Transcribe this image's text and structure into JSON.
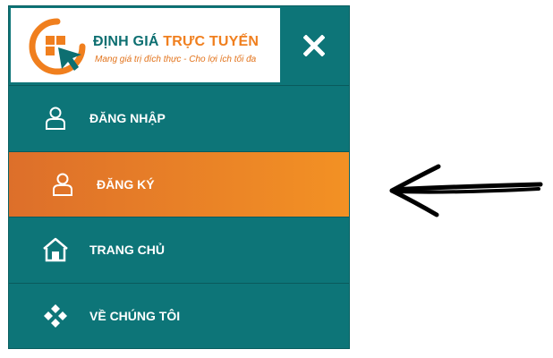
{
  "logo": {
    "title_part1": "ĐỊNH GIÁ",
    "title_part2": "TRỰC TUYẾN",
    "tagline": "Mang giá trị đích thực - Cho lợi ích tối đa"
  },
  "menu": {
    "close_icon": "close-icon",
    "items": [
      {
        "label": "ĐĂNG NHẬP",
        "icon": "user-icon",
        "active": false
      },
      {
        "label": "ĐĂNG KÝ",
        "icon": "user-icon",
        "active": true
      },
      {
        "label": "TRANG CHỦ",
        "icon": "home-icon",
        "active": false
      },
      {
        "label": "VỀ CHÚNG TÔI",
        "icon": "diamond-cluster-icon",
        "active": false
      }
    ]
  },
  "colors": {
    "menu_background": "#0d7578",
    "active_start": "#dd6f2a",
    "active_end": "#f39124",
    "brand_teal": "#0d6f71",
    "brand_orange": "#f07f1e"
  },
  "annotation": {
    "icon": "arrow-left-icon"
  }
}
